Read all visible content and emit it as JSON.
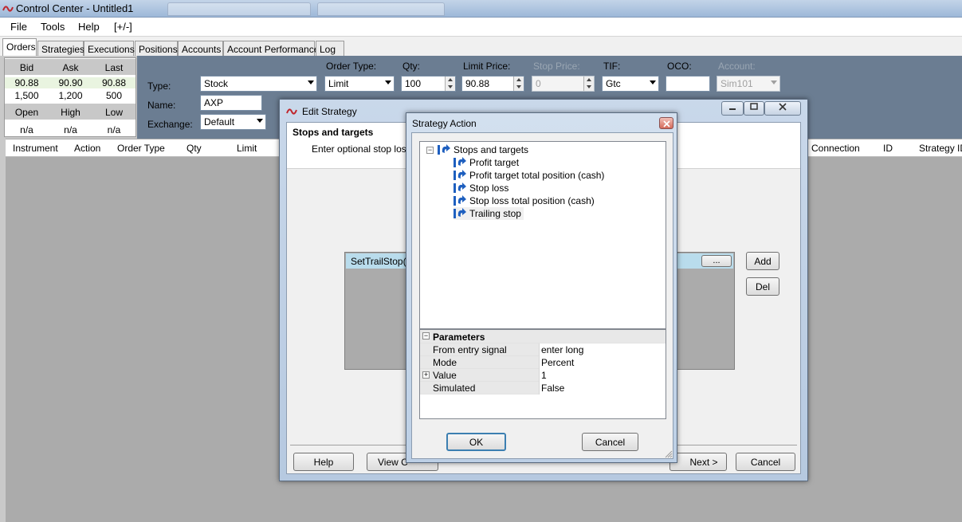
{
  "window": {
    "title": "Control Center - Untitled1"
  },
  "menu": [
    "File",
    "Tools",
    "Help",
    "[+/-]"
  ],
  "tabs": [
    "Orders",
    "Strategies",
    "Executions",
    "Positions",
    "Accounts",
    "Account Performance",
    "Log"
  ],
  "quote": {
    "headers1": [
      "Bid",
      "Ask",
      "Last"
    ],
    "row1": [
      "90.88",
      "90.90",
      "90.88"
    ],
    "row2": [
      "1,500",
      "1,200",
      "500"
    ],
    "headers2": [
      "Open",
      "High",
      "Low"
    ],
    "row3": [
      "n/a",
      "n/a",
      "n/a"
    ]
  },
  "order": {
    "type_label": "Type:",
    "type_value": "Stock",
    "name_label": "Name:",
    "name_value": "AXP",
    "exchange_label": "Exchange:",
    "exchange_value": "Default",
    "order_type_label": "Order Type:",
    "order_type_value": "Limit",
    "qty_label": "Qty:",
    "qty_value": "100",
    "limit_label": "Limit Price:",
    "limit_value": "90.88",
    "stop_label": "Stop Price:",
    "stop_value": "0",
    "tif_label": "TIF:",
    "tif_value": "Gtc",
    "oco_label": "OCO:",
    "oco_value": "",
    "account_label": "Account:",
    "account_value": "Sim101"
  },
  "grid": {
    "columns_left": [
      "Instrument",
      "Action",
      "Order Type",
      "Qty",
      "Limit"
    ],
    "columns_right": [
      "Connection",
      "ID",
      "Strategy ID"
    ]
  },
  "edit_strategy": {
    "title": "Edit Strategy",
    "heading": "Stops and targets",
    "subtext": "Enter optional stop loss a",
    "row_text": "SetTrailStop(\"",
    "ellipsis": "...",
    "add": "Add",
    "del": "Del",
    "help": "Help",
    "view_code": "View C",
    "next": "Next >",
    "cancel": "Cancel"
  },
  "strategy_action": {
    "title": "Strategy Action",
    "tree_root": "Stops and targets",
    "tree_items": [
      "Profit target",
      "Profit target total position (cash)",
      "Stop loss",
      "Stop loss total position (cash)",
      "Trailing stop"
    ],
    "params_title": "Parameters",
    "params": [
      {
        "name": "From entry signal",
        "value": "enter long"
      },
      {
        "name": "Mode",
        "value": "Percent"
      },
      {
        "name": "Value",
        "value": "1"
      },
      {
        "name": "Simulated",
        "value": "False"
      }
    ],
    "ok": "OK",
    "cancel": "Cancel"
  },
  "colors": {
    "accent": "#3c7fb1",
    "selection": "#b9dcec",
    "order_bar": "#6b7d92"
  }
}
